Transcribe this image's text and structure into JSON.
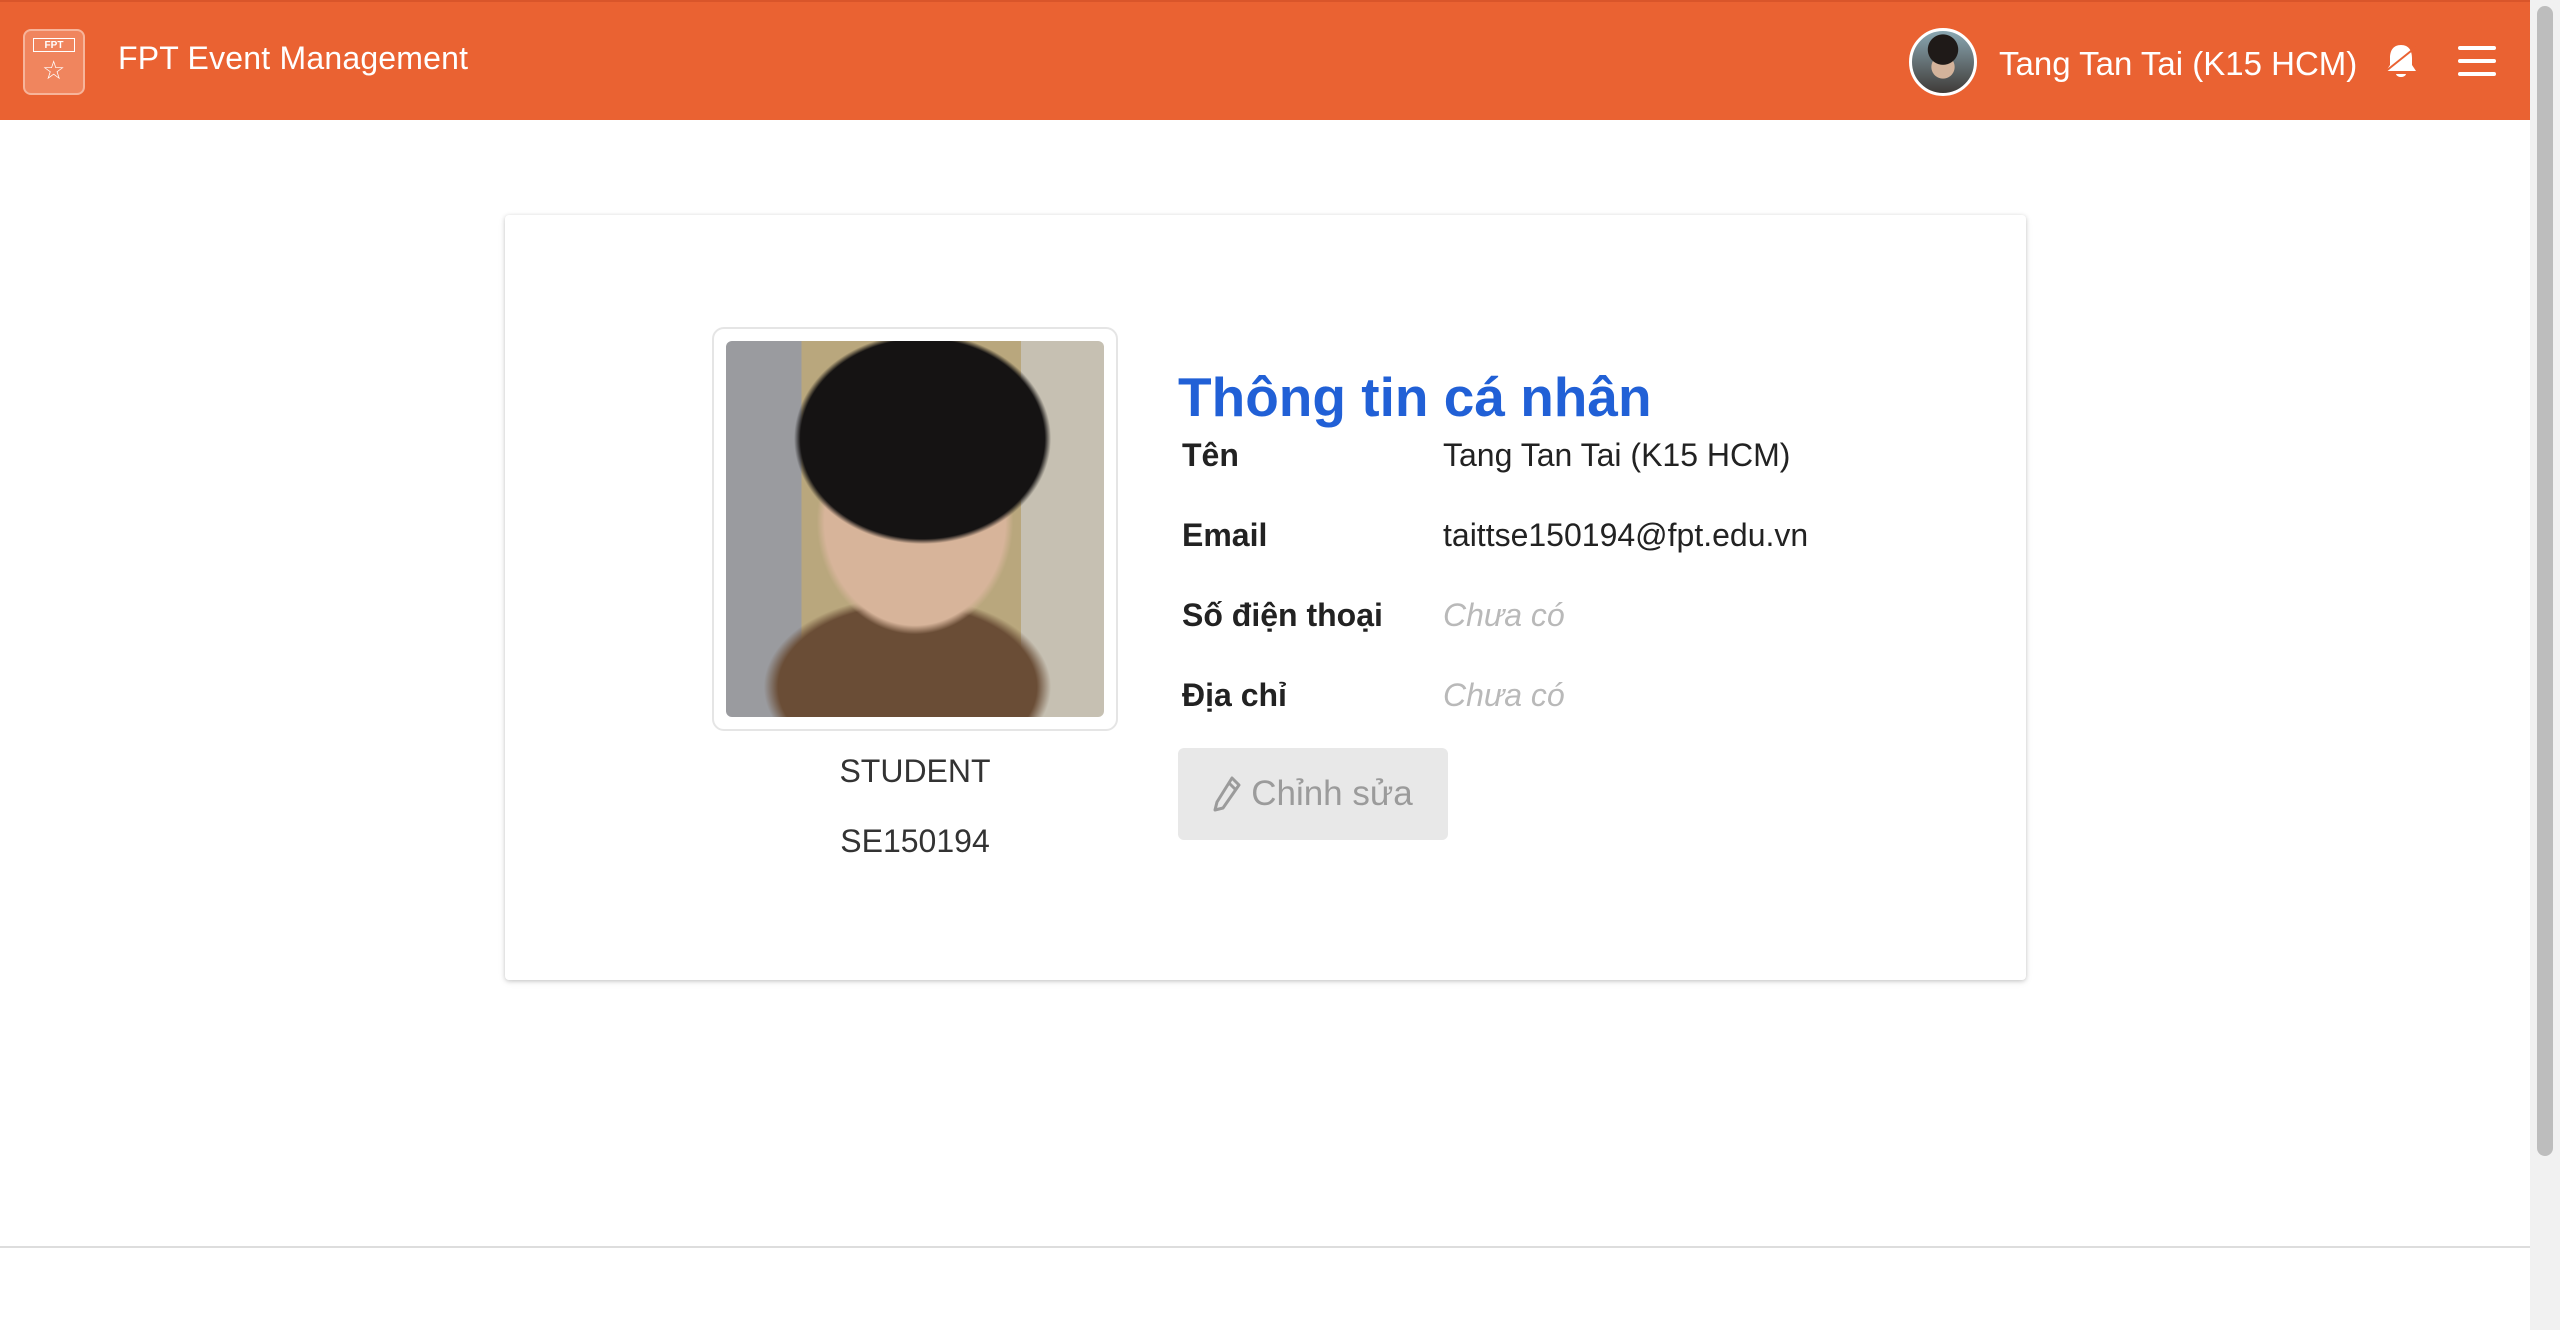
{
  "header": {
    "brand_logo_text": "FPT",
    "app_title": "FPT Event Management",
    "username": "Tang Tan Tai (K15 HCM)",
    "icons": [
      "fpt-logo-icon",
      "user-avatar",
      "bell-icon",
      "menu-icon"
    ]
  },
  "profile": {
    "title": "Thông tin cá nhân",
    "role": "STUDENT",
    "student_id": "SE150194",
    "fields": [
      {
        "label": "Tên",
        "value": "Tang Tan Tai (K15 HCM)"
      },
      {
        "label": "Email",
        "value": "taittse150194@fpt.edu.vn"
      },
      {
        "label": "Số điện thoại",
        "value": "Chưa có"
      },
      {
        "label": "Địa chỉ",
        "value": "Chưa có"
      }
    ],
    "edit_button": "Chỉnh sửa"
  },
  "colors": {
    "header": "#ea6232",
    "title": "#2160d6",
    "placeholder": "#b9b9b9",
    "button_background": "#e8e8e8"
  }
}
